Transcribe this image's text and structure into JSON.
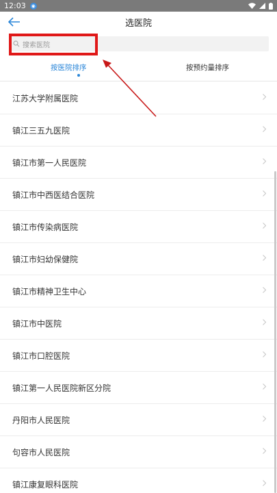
{
  "status_bar": {
    "time": "12:03",
    "notification_icon": "location-badge-icon"
  },
  "header": {
    "title": "选医院"
  },
  "search": {
    "placeholder": "搜索医院"
  },
  "sort_tabs": [
    {
      "label": "按医院排序",
      "active": true
    },
    {
      "label": "按预约量排序",
      "active": false
    }
  ],
  "hospitals": [
    "江苏大学附属医院",
    "镇江三五九医院",
    "镇江市第一人民医院",
    "镇江市中西医结合医院",
    "镇江市传染病医院",
    "镇江市妇幼保健院",
    "镇江市精神卫生中心",
    "镇江市中医院",
    "镇江市口腔医院",
    "镇江第一人民医院新区分院",
    "丹阳市人民医院",
    "句容市人民医院",
    "镇江康复眼科医院"
  ],
  "colors": {
    "accent": "#2a86d8",
    "annotation": "#e01818",
    "status_bar": "#7a7a7a"
  }
}
